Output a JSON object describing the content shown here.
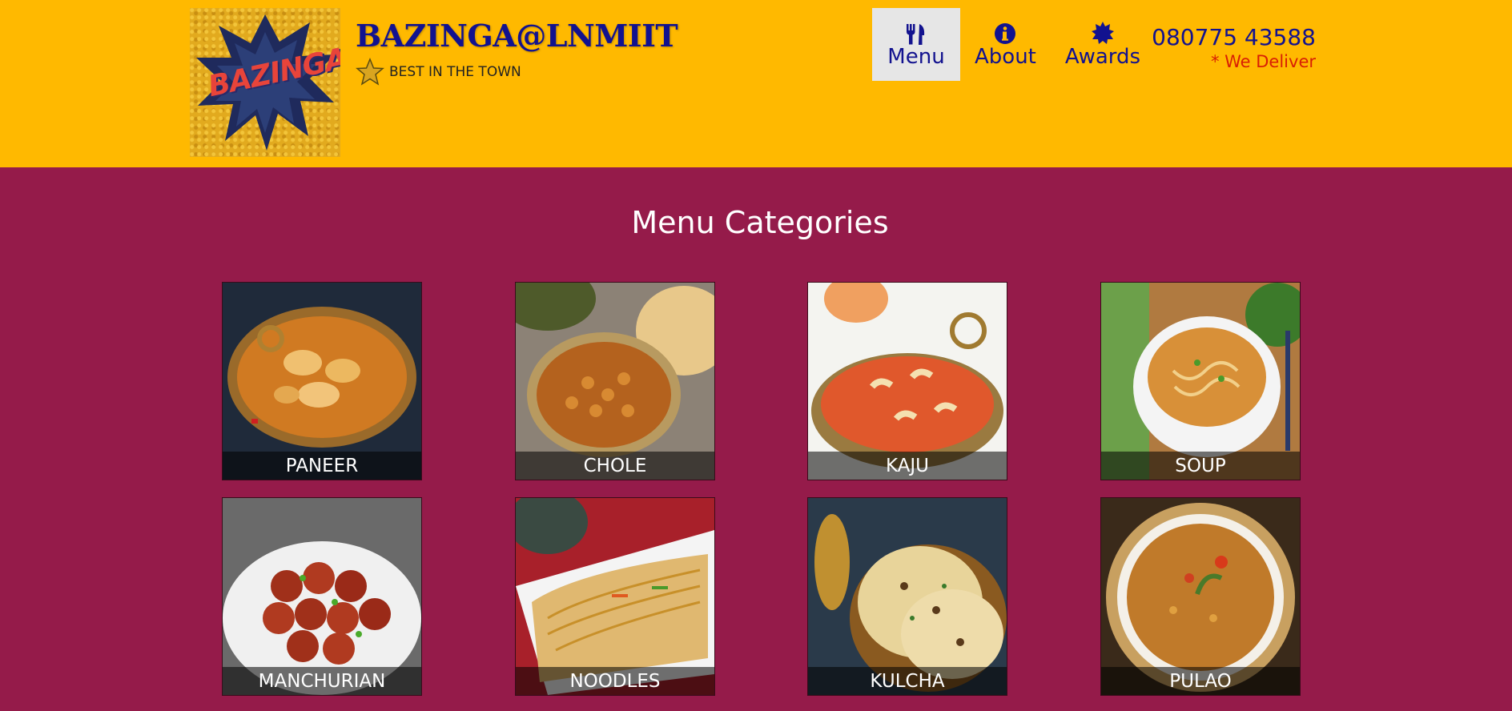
{
  "header": {
    "logo_text": "BAZINGA!",
    "brand_title": "BAZINGA@LNMIIT",
    "brand_tagline": "BEST IN THE TOWN",
    "nav": [
      {
        "label": "Menu",
        "icon": "cutlery-icon"
      },
      {
        "label": "About",
        "icon": "info-icon"
      },
      {
        "label": "Awards",
        "icon": "badge-icon"
      }
    ],
    "phone": "080775 43588",
    "delivery_note": "* We Deliver"
  },
  "main": {
    "title": "Menu Categories",
    "categories": [
      {
        "label": "PANEER"
      },
      {
        "label": "CHOLE"
      },
      {
        "label": "KAJU"
      },
      {
        "label": "SOUP"
      },
      {
        "label": "MANCHURIAN"
      },
      {
        "label": "NOODLES"
      },
      {
        "label": "KULCHA"
      },
      {
        "label": "PULAO"
      }
    ]
  },
  "colors": {
    "header_bg": "#ffb900",
    "page_bg": "#951b4a",
    "nav_text": "#12128f",
    "delivery_text": "#d81e05"
  }
}
